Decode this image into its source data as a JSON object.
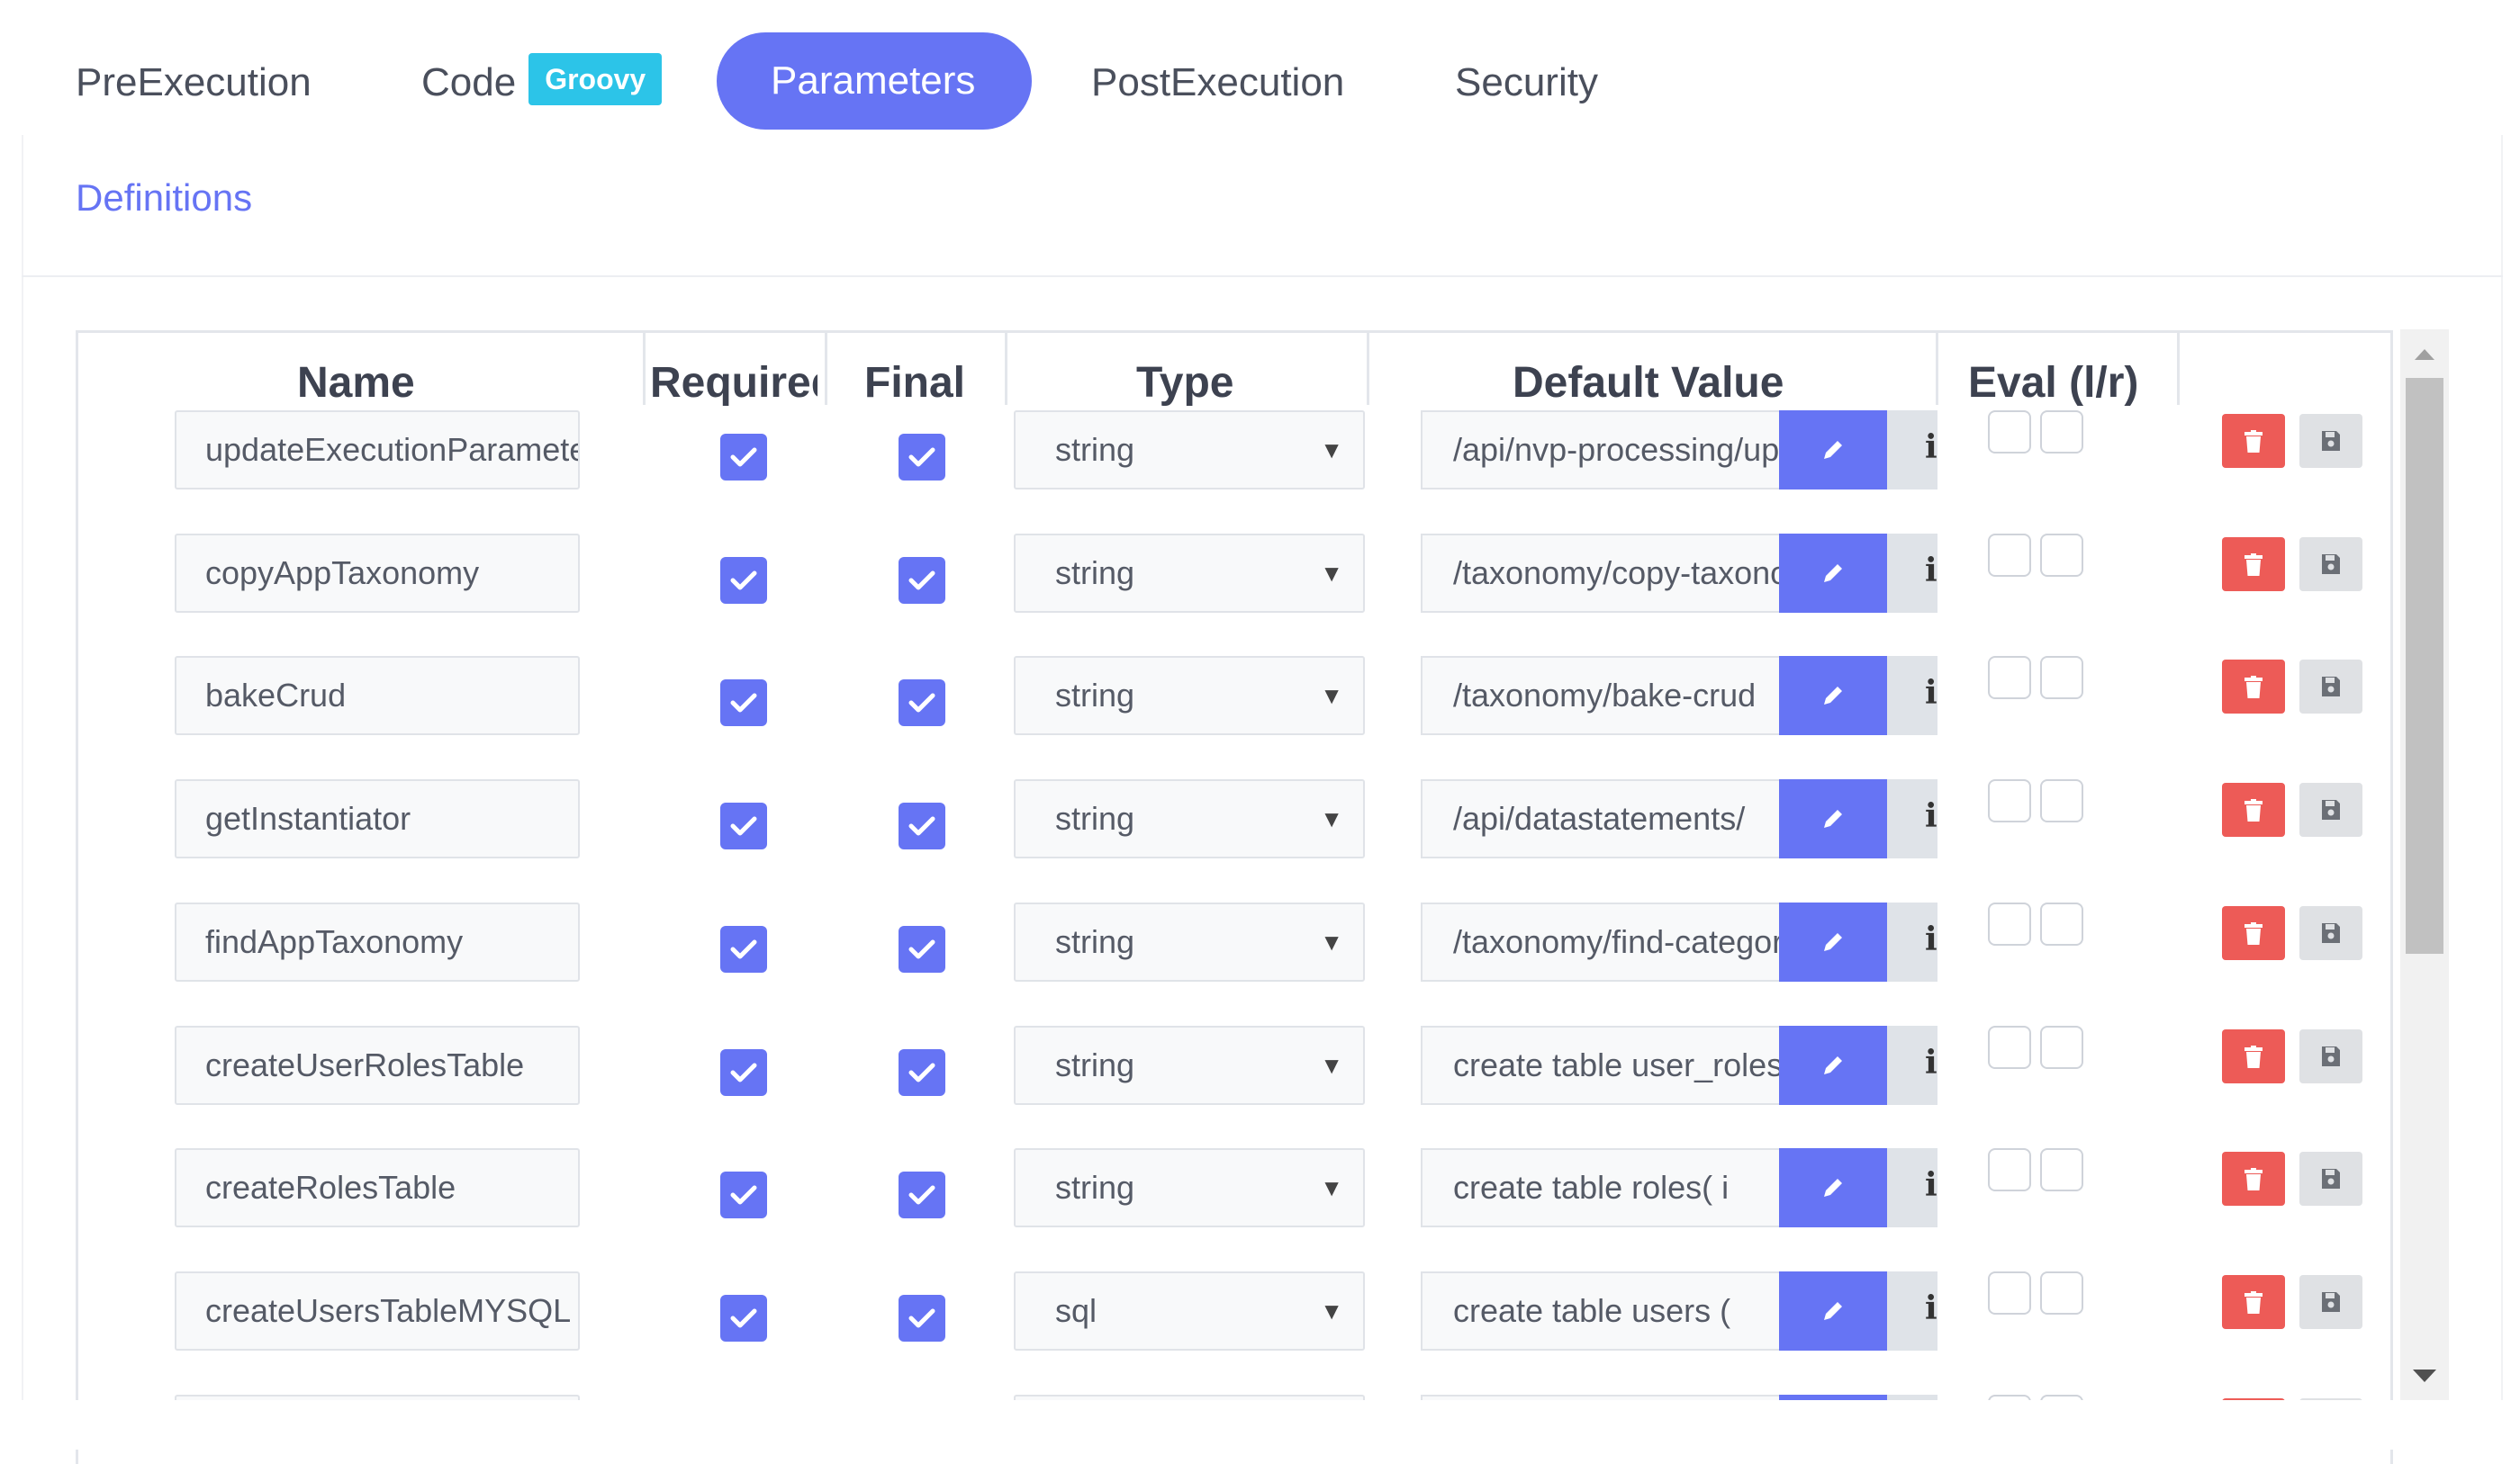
{
  "tabs": [
    {
      "label": "PreExecution",
      "active": false
    },
    {
      "label": "Code",
      "badge": "Groovy",
      "active": false
    },
    {
      "label": "Parameters",
      "active": true
    },
    {
      "label": "PostExecution",
      "active": false
    },
    {
      "label": "Security",
      "active": false
    }
  ],
  "section_title": "Definitions",
  "table": {
    "headers": {
      "name": "Name",
      "required": "Required",
      "final": "Final",
      "type": "Type",
      "default_value": "Default Value",
      "eval": "Eval (l/r)"
    },
    "rows": [
      {
        "name": "updateExecutionParameter",
        "required": true,
        "final": true,
        "type": "string",
        "default": "/api/nvp-processing/update"
      },
      {
        "name": "copyAppTaxonomy",
        "required": true,
        "final": true,
        "type": "string",
        "default": "/taxonomy/copy-taxonomy"
      },
      {
        "name": "bakeCrud",
        "required": true,
        "final": true,
        "type": "string",
        "default": "/taxonomy/bake-crud"
      },
      {
        "name": "getInstantiator",
        "required": true,
        "final": true,
        "type": "string",
        "default": "/api/datastatements/"
      },
      {
        "name": "findAppTaxonomy",
        "required": true,
        "final": true,
        "type": "string",
        "default": "/taxonomy/find-category"
      },
      {
        "name": "createUserRolesTable",
        "required": true,
        "final": true,
        "type": "string",
        "default": "create table user_roles"
      },
      {
        "name": "createRolesTable",
        "required": true,
        "final": true,
        "type": "string",
        "default": "create table roles(    i"
      },
      {
        "name": "createUsersTableMYSQL",
        "required": true,
        "final": true,
        "type": "sql",
        "default": "create table users ("
      }
    ]
  },
  "icons": {
    "edit": "pencil-icon",
    "info": "info-icon",
    "delete": "trash-icon",
    "save": "floppy-disk-icon",
    "checkbox": "check-icon"
  },
  "colors": {
    "accent": "#6674f4",
    "badge": "#2cc4e8",
    "danger": "#ed5b57",
    "muted_button": "#dfe1e4"
  }
}
